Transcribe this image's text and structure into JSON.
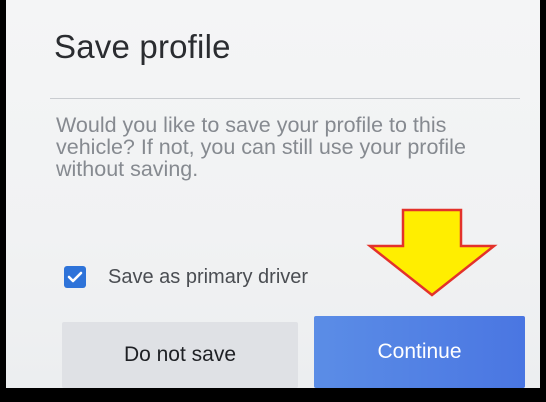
{
  "dialog": {
    "title": "Save profile",
    "body": "Would you like to save your profile to this vehicle? If not, you can still use your profile without saving.",
    "checkbox": {
      "label": "Save as primary driver",
      "checked": true
    },
    "buttons": {
      "secondary_label": "Do not save",
      "primary_label": "Continue"
    }
  },
  "colors": {
    "accent": "#4a7be3",
    "checkbox": "#2e73d9",
    "annotation_arrow_fill": "#ffee00",
    "annotation_arrow_stroke": "#e3322b"
  },
  "annotation": {
    "icon": "down-arrow-icon"
  }
}
